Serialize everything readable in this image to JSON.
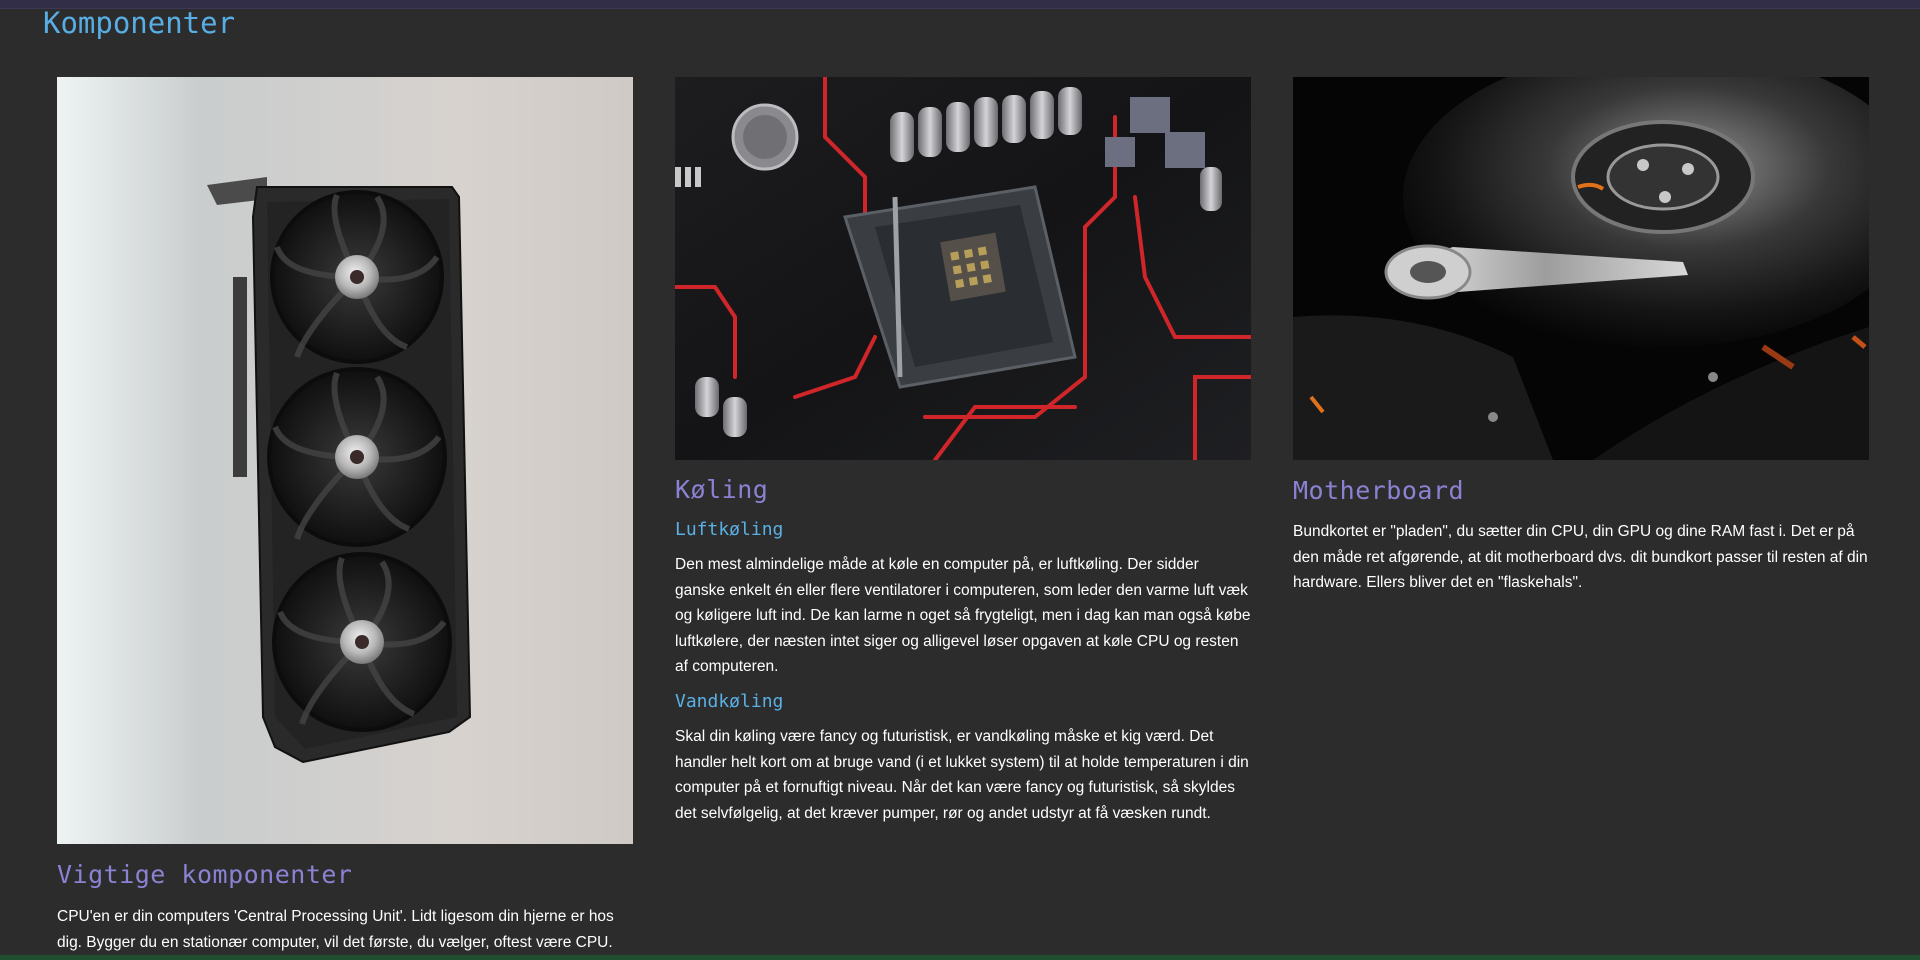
{
  "page": {
    "title": "Komponenter"
  },
  "cards": [
    {
      "image_subject": "graphics card with three fans",
      "heading": "Vigtige komponenter",
      "body": "CPU'en er din computers 'Central Processing Unit'. Lidt ligesom din hjerne er hos dig. Bygger du en stationær computer, vil det første, du vælger, oftest være CPU."
    },
    {
      "image_subject": "motherboard CPU socket with red traces",
      "heading": "Køling",
      "sections": [
        {
          "subheading": "Luftkøling",
          "body": "Den mest almindelige måde at køle en computer på, er luftkøling. Der sidder ganske enkelt én eller flere ventilatorer i computeren, som leder den varme luft væk og køligere luft ind. De kan larme n oget så frygteligt, men i dag kan man også købe luftkølere, der næsten intet siger og alligevel løser opgaven at køle CPU og resten af computeren."
        },
        {
          "subheading": "Vandkøling",
          "body": "Skal din køling være fancy og futuristisk, er vandkøling måske et kig værd. Det handler helt kort om at bruge vand (i et lukket system) til at holde temperaturen i din computer på et fornuftigt niveau. Når det kan være fancy og futuristisk, så skyldes det selvfølgelig, at det kræver pumper, rør og andet udstyr at få væsken rundt."
        }
      ]
    },
    {
      "image_subject": "open hard disk drive with platter and read arm",
      "heading": "Motherboard",
      "body": "Bundkortet er \"pladen\", du sætter din CPU, din GPU og dine RAM fast i. Det er på den måde ret afgørende, at dit motherboard dvs. dit bundkort passer til resten af din hardware. Ellers bliver det en \"flaskehals\"."
    }
  ],
  "colors": {
    "background": "#2c2c2c",
    "page_title": "#58aee4",
    "card_heading": "#8a82d2",
    "sub_heading": "#5ab0e4",
    "body_text": "#ffffff",
    "top_bar": "#332e48",
    "bottom_bar": "#1f4f2f"
  }
}
